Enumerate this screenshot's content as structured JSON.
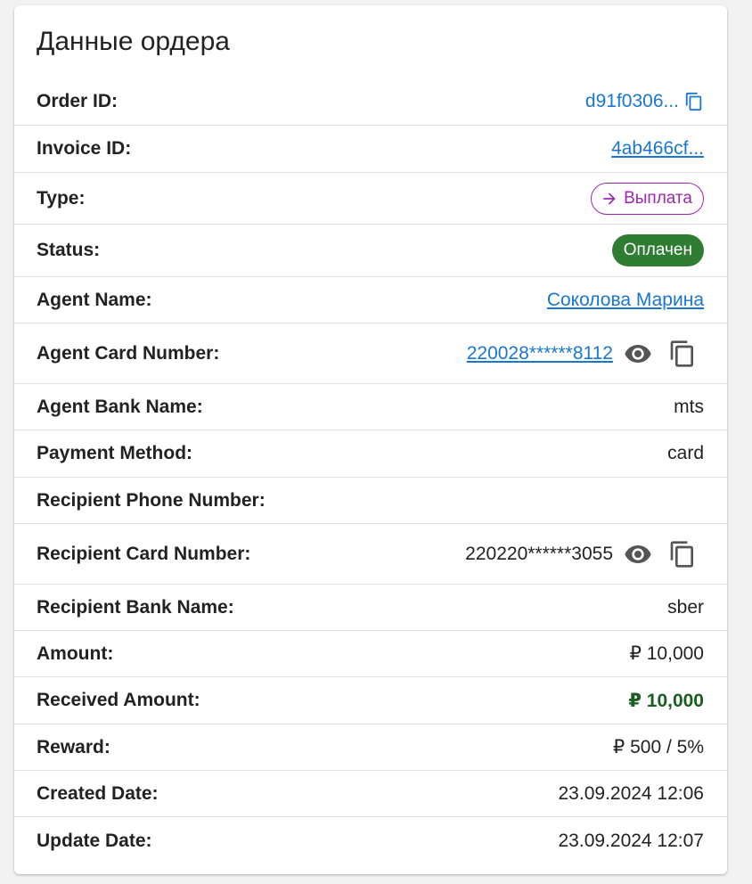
{
  "title": "Данные ордера",
  "rows": {
    "order_id": {
      "label": "Order ID:",
      "value": "d91f0306..."
    },
    "invoice_id": {
      "label": "Invoice ID:",
      "value": "4ab466cf..."
    },
    "type": {
      "label": "Type:",
      "value": "Выплата"
    },
    "status": {
      "label": "Status:",
      "value": "Оплачен"
    },
    "agent_name": {
      "label": "Agent Name:",
      "value": "Соколова Марина"
    },
    "agent_card": {
      "label": "Agent Card Number:",
      "value": "220028******8112"
    },
    "agent_bank": {
      "label": "Agent Bank Name:",
      "value": "mts"
    },
    "payment_method": {
      "label": "Payment Method:",
      "value": "card"
    },
    "recipient_phone": {
      "label": "Recipient Phone Number:",
      "value": ""
    },
    "recipient_card": {
      "label": "Recipient Card Number:",
      "value": "220220******3055"
    },
    "recipient_bank": {
      "label": "Recipient Bank Name:",
      "value": "sber"
    },
    "amount": {
      "label": "Amount:",
      "value": "₽ 10,000"
    },
    "received_amount": {
      "label": "Received Amount:",
      "value": "₽ 10,000"
    },
    "reward": {
      "label": "Reward:",
      "value": "₽ 500 / 5%"
    },
    "created_date": {
      "label": "Created Date:",
      "value": "23.09.2024 12:06"
    },
    "update_date": {
      "label": "Update Date:",
      "value": "23.09.2024 12:07"
    }
  },
  "colors": {
    "link": "#1976d2",
    "type_chip": "#9c27b0",
    "status_chip": "#2e7d32",
    "received_amount": "#1b5e20",
    "icon": "#555555"
  },
  "icons": {
    "copy": "copy-icon",
    "eye": "eye-icon",
    "arrow": "arrow-right-icon"
  }
}
